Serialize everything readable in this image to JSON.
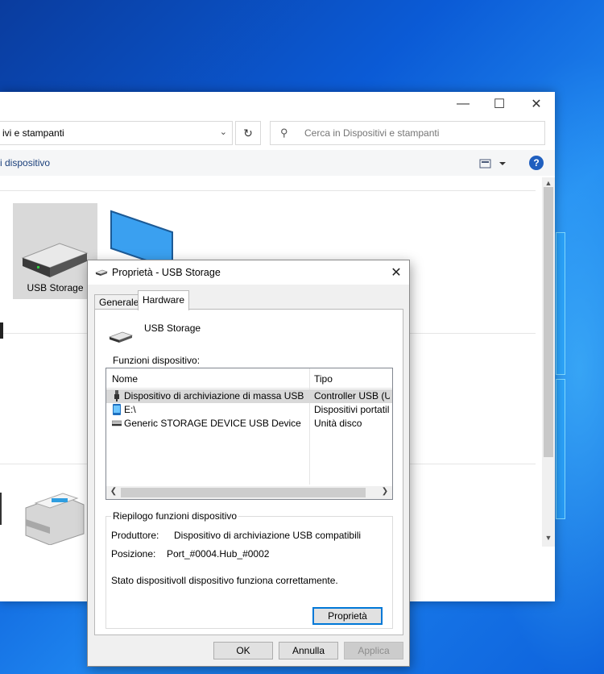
{
  "explorer": {
    "address_text": "ivi e stampanti",
    "search_placeholder": "Cerca in Dispositivi e stampanti",
    "cmd_link": "i dispositivo",
    "help_label": "?",
    "devices": [
      {
        "label": "USB Storage"
      }
    ]
  },
  "dialog": {
    "title": "Proprietà - USB Storage",
    "tabs": [
      {
        "label": "Generale"
      },
      {
        "label": "Hardware",
        "active": true
      }
    ],
    "device_name": "USB Storage",
    "functions_label": "Funzioni dispositivo:",
    "columns": {
      "name": "Nome",
      "type": "Tipo"
    },
    "rows": [
      {
        "name": "Dispositivo di archiviazione di massa USB",
        "type": "Controller USB (Uni...",
        "icon": "usb-plug-icon",
        "selected": true
      },
      {
        "name": "E:\\",
        "type": "Dispositivi portatili",
        "icon": "portable-device-icon"
      },
      {
        "name": "Generic STORAGE DEVICE USB Device",
        "type": "Unità disco",
        "icon": "disk-drive-icon"
      }
    ],
    "summary": {
      "title": "Riepilogo funzioni dispositivo",
      "manufacturer_label": "Produttore:",
      "manufacturer_value": "Dispositivo di archiviazione USB compatibili",
      "location_label": "Posizione:",
      "location_value": "Port_#0004.Hub_#0002",
      "status_label": "Stato dispositivo:",
      "status_value": "Il dispositivo funziona correttamente.",
      "properties_button": "Proprietà"
    },
    "buttons": {
      "ok": "OK",
      "cancel": "Annulla",
      "apply": "Applica"
    }
  }
}
